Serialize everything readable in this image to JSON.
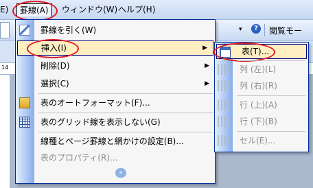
{
  "menubar": {
    "first": "E)",
    "keisen": "罫線(A)",
    "window": "ウィンドウ(W)",
    "help": "ヘルプ(H)"
  },
  "toolbar": {
    "dropdown_arrow": "▾",
    "help_glyph": "?",
    "reading_mode": "閲覧モー"
  },
  "ruler": {
    "mark": "14"
  },
  "menu": {
    "items": [
      {
        "label": "罫線を引く(W)",
        "icon": "pen-icon"
      },
      {
        "label": "挿入(I)",
        "icon": "",
        "submenu_arrow": "▶"
      },
      {
        "label": "削除(D)",
        "icon": "",
        "submenu_arrow": "▶"
      },
      {
        "label": "選択(C)",
        "icon": "",
        "submenu_arrow": "▶"
      },
      {
        "label": "表のオートフォーマット(F)...",
        "icon": "autoformat-icon"
      },
      {
        "label": "表のグリッド線を表示しない(G)",
        "icon": "grid-icon"
      },
      {
        "label": "線種とページ罫線と網かけの設定(B)...",
        "icon": ""
      },
      {
        "label": "表のプロパティ(R)...",
        "icon": "",
        "disabled": true
      }
    ],
    "expand_glyph": "»"
  },
  "submenu": {
    "items": [
      {
        "label": "表(T)...",
        "icon": "table-icon"
      },
      {
        "label": "列 (左)(L)",
        "icon": "insert-column-left-icon",
        "disabled": true
      },
      {
        "label": "列 (右)(R)",
        "icon": "insert-column-right-icon",
        "disabled": true
      },
      {
        "label": "行 (上)(A)",
        "icon": "insert-row-above-icon",
        "disabled": true
      },
      {
        "label": "行 (下)(B)",
        "icon": "insert-row-below-icon",
        "disabled": true
      },
      {
        "label": "セル(E)...",
        "icon": "insert-cell-icon",
        "disabled": true
      }
    ]
  },
  "colors": {
    "highlight": "#ffeec2",
    "highlight_border": "#000080",
    "annotation_ring": "#e0191f",
    "menu_border": "#002d96"
  }
}
